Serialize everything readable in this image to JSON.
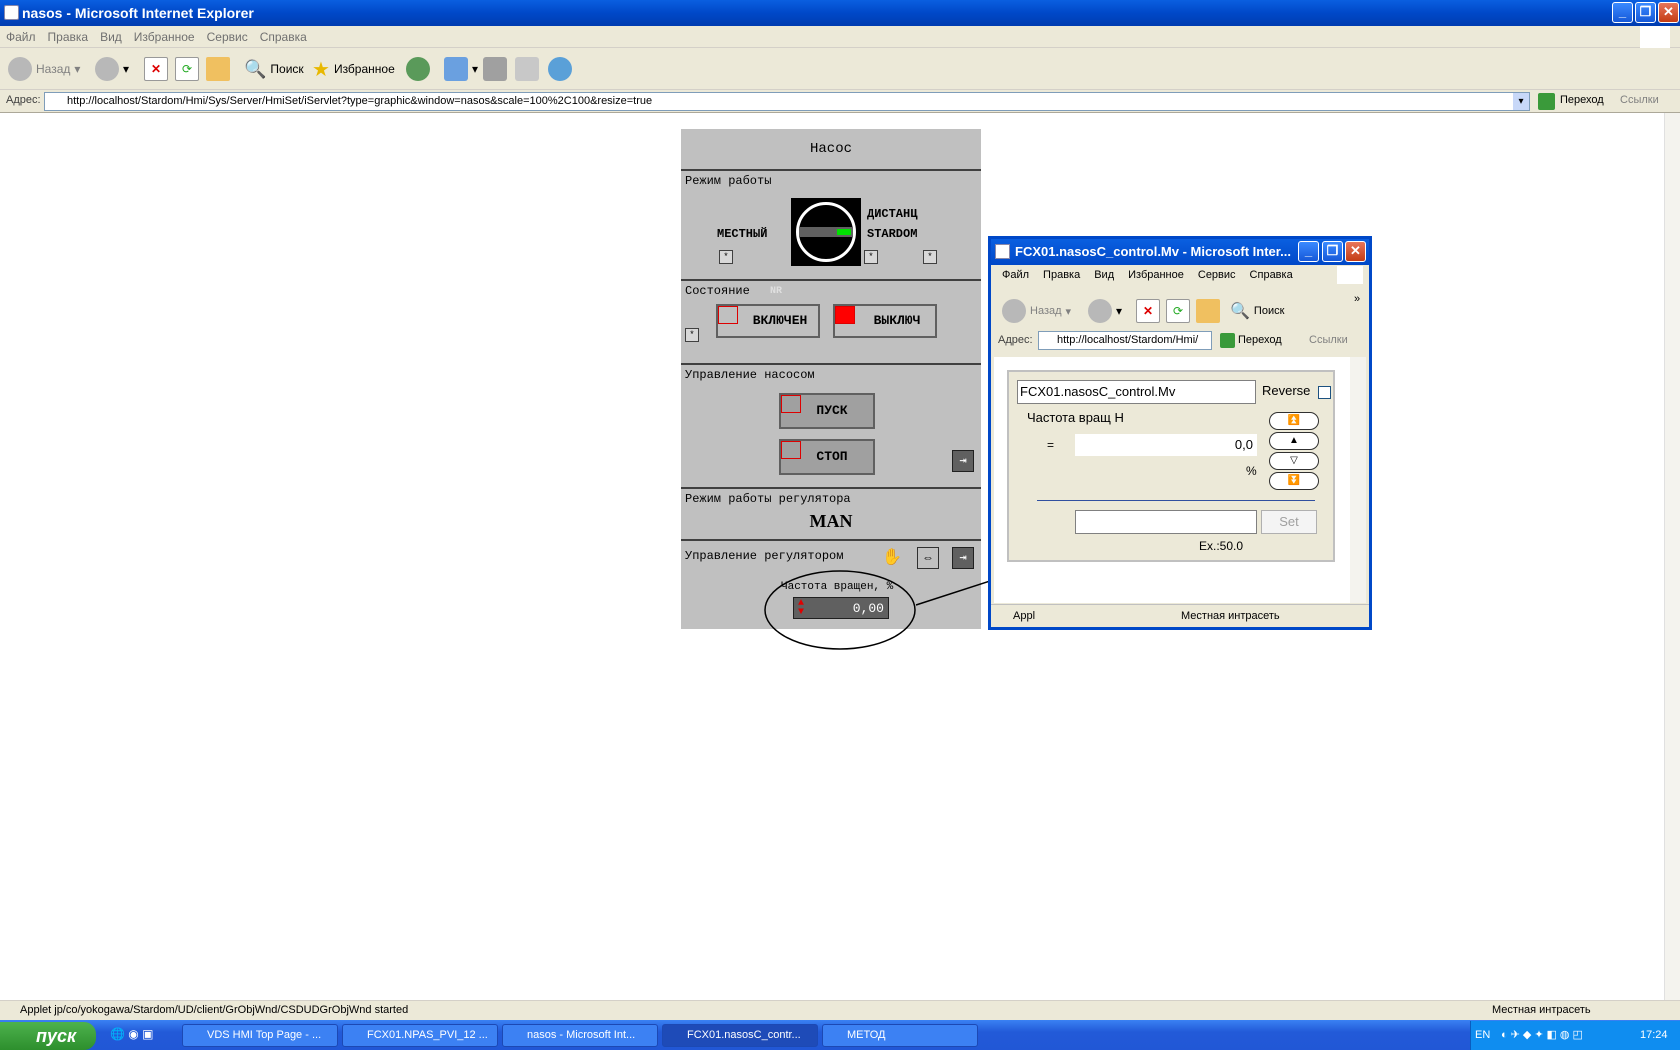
{
  "window": {
    "title": "nasos - Microsoft Internet Explorer"
  },
  "menu": [
    "Файл",
    "Правка",
    "Вид",
    "Избранное",
    "Сервис",
    "Справка"
  ],
  "toolbar": {
    "back": "Назад",
    "search": "Поиск",
    "favorites": "Избранное"
  },
  "address": {
    "label": "Адрес:",
    "url": "http://localhost/Stardom/Hmi/Sys/Server/HmiSet/iServlet?type=graphic&window=nasos&scale=100%2C100&resize=true",
    "go": "Переход",
    "links": "Ссылки"
  },
  "hmi": {
    "title": "Насос",
    "mode_label": "Режим работы",
    "local": "МЕСТНЫЙ",
    "remote": "ДИСТАНЦ",
    "stardom": "STARDOM",
    "state_label": "Состояние",
    "state_tag": "NR",
    "on": "ВКЛЮЧЕН",
    "off": "ВЫКЛЮЧ",
    "pump_ctrl": "Управление насосом",
    "start": "ПУСК",
    "stop": "СТОП",
    "reg_mode_label": "Режим работы регулятора",
    "reg_mode": "MAN",
    "reg_ctrl": "Управление регулятором",
    "freq_label": "Частота вращен, %",
    "freq_value": "0,00"
  },
  "popup": {
    "title": "FCX01.nasosC_control.Mv - Microsoft Inter...",
    "menu": [
      "Файл",
      "Правка",
      "Вид",
      "Избранное",
      "Сервис",
      "Справка"
    ],
    "back": "Назад",
    "search": "Поиск",
    "addr_label": "Адрес:",
    "url": "http://localhost/Stardom/Hmi/",
    "go": "Переход",
    "links": "Ссылки",
    "tag": "FCX01.nasosC_control.Mv",
    "reverse": "Reverse",
    "param": "Частота вращ Н",
    "eq": "=",
    "value": "0,0",
    "unit": "%",
    "set": "Set",
    "example": "Ex.:50.0",
    "status_left": "Appl",
    "status_zone": "Местная интрасеть"
  },
  "status": {
    "text": "Applet jp/co/yokogawa/Stardom/UD/client/GrObjWnd/CSDUDGrObjWnd started",
    "zone": "Местная интрасеть"
  },
  "taskbar": {
    "start": "пуск",
    "tasks": [
      "VDS HMI Top Page - ...",
      "FCX01.NPAS_PVI_12 ...",
      "nasos - Microsoft Int...",
      "FCX01.nasosC_contr...",
      "МЕТОД"
    ],
    "lang": "EN",
    "time": "17:24"
  },
  "colors": {
    "accent": "#0048c8",
    "green": "#00c000",
    "red": "#ff0000"
  }
}
